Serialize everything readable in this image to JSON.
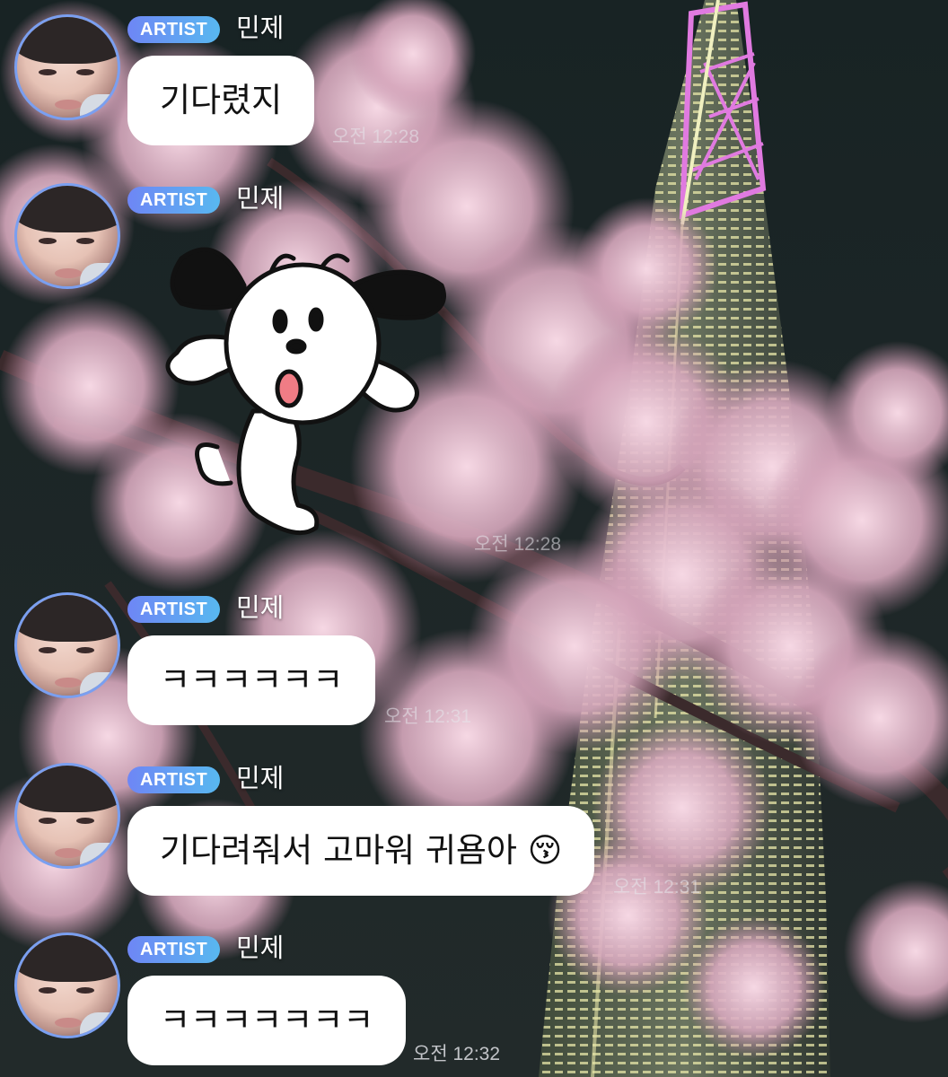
{
  "badge_label": "ARTIST",
  "sender_name": "민제",
  "colors": {
    "badge_start": "#6e86f5",
    "badge_end": "#58b8f0",
    "avatar_ring": "#7a9ff0",
    "bubble_bg": "#ffffff",
    "tower_glow": "#d96ad8"
  },
  "messages": [
    {
      "type": "text",
      "text": "기다렸지",
      "time": "오전 12:28"
    },
    {
      "type": "sticker",
      "sticker": "surprised-white-dog-sticker",
      "time": "오전 12:28"
    },
    {
      "type": "text",
      "text": "ㅋㅋㅋㅋㅋㅋ",
      "time": "오전 12:31"
    },
    {
      "type": "text",
      "text": "기다려줘서 고마워 귀욤아 😚",
      "time": "오전 12:31"
    },
    {
      "type": "text",
      "text": "ㅋㅋㅋㅋㅋㅋㅋ",
      "time": "오전 12:32"
    }
  ]
}
